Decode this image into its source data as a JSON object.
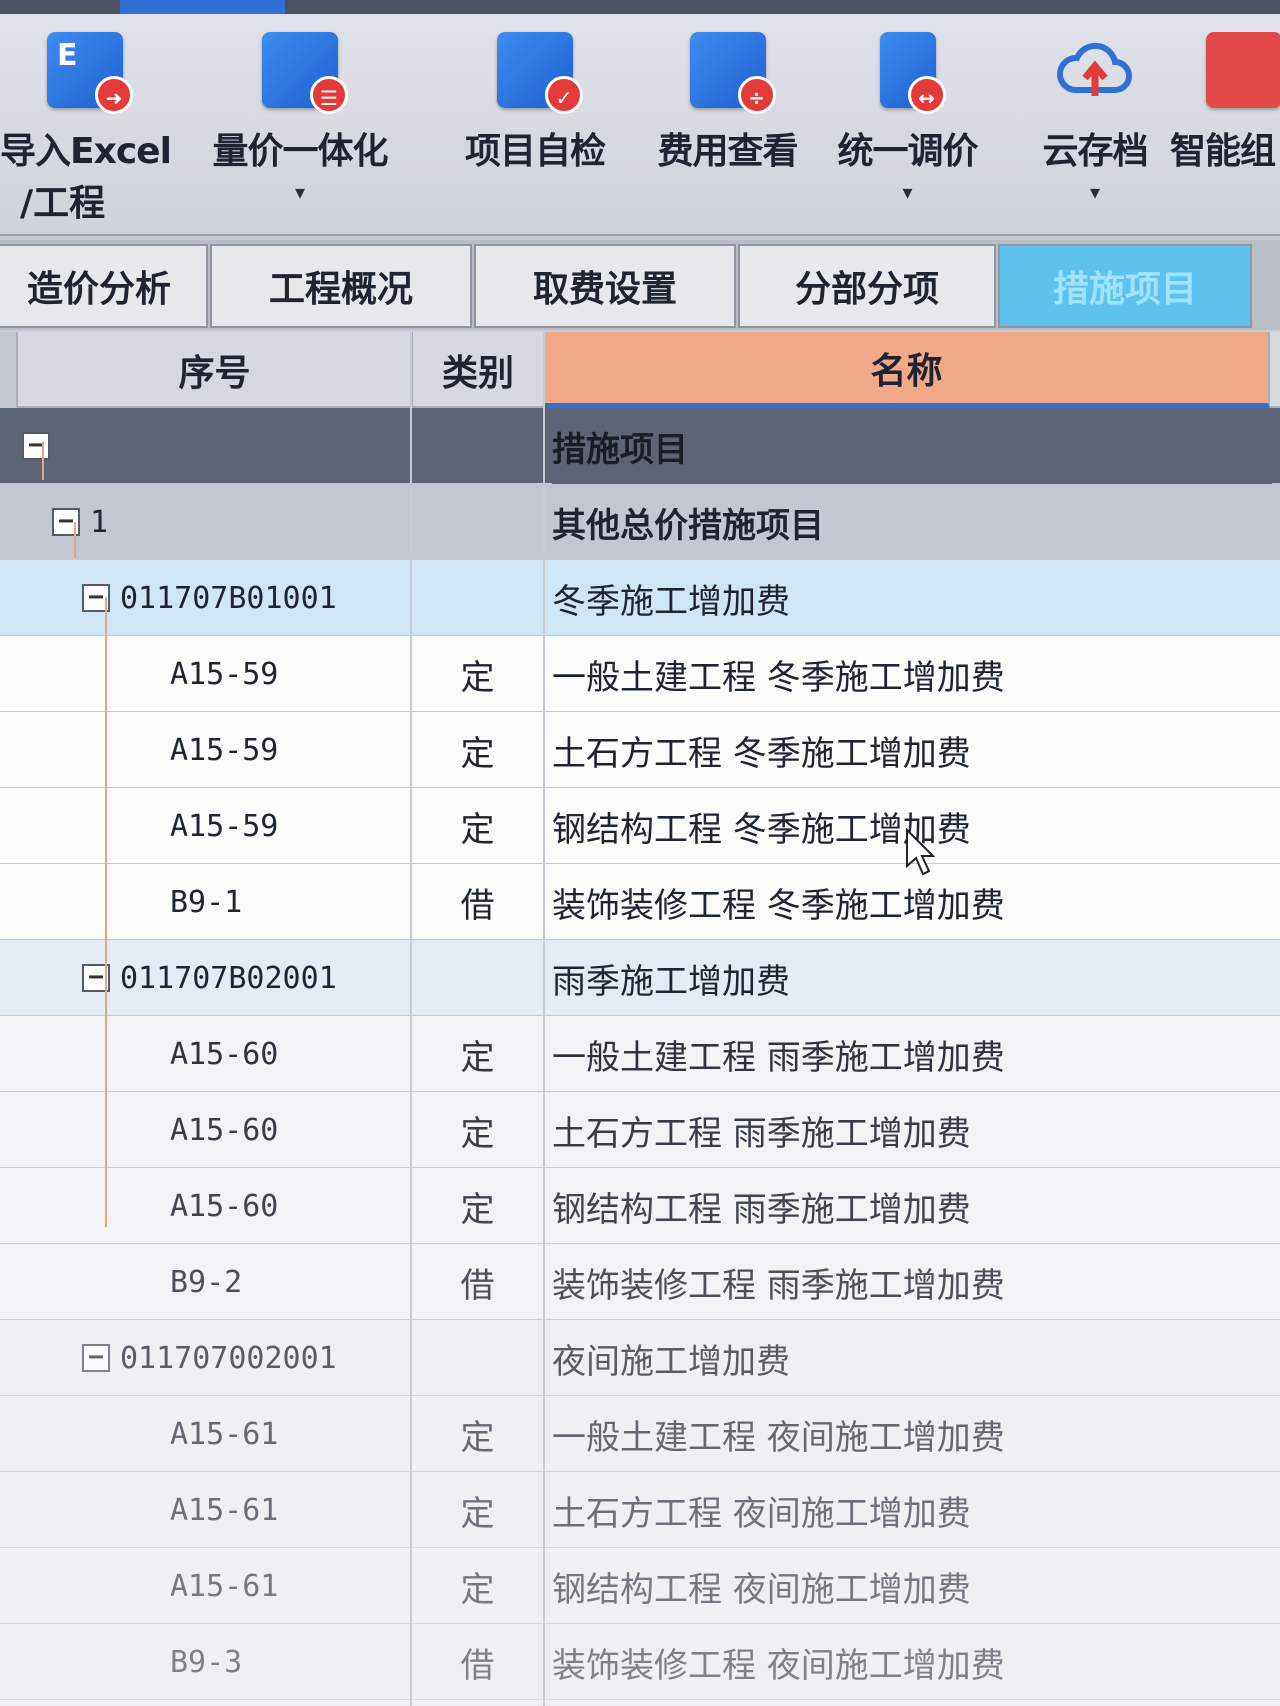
{
  "toolbar": {
    "tools": [
      {
        "label": "导入Excel",
        "label2": "/工程",
        "glyph": "E",
        "icon": "excel-import-icon",
        "caret": "▾"
      },
      {
        "label": "量价一体化",
        "label2": "",
        "glyph": "",
        "icon": "document-list-icon",
        "caret": "▾"
      },
      {
        "label": "项目自检",
        "label2": "",
        "glyph": "",
        "icon": "checklist-icon",
        "caret": ""
      },
      {
        "label": "费用查看",
        "label2": "",
        "glyph": "",
        "icon": "fee-view-icon",
        "caret": ""
      },
      {
        "label": "统一调价",
        "label2": "",
        "glyph": "",
        "icon": "price-adjust-icon",
        "caret": "▾"
      },
      {
        "label": "云存档",
        "label2": "",
        "glyph": "",
        "icon": "cloud-upload-icon",
        "caret": "▾"
      },
      {
        "label": "智能组",
        "label2": "",
        "glyph": "",
        "icon": "smart-group-icon",
        "caret": ""
      }
    ]
  },
  "tabs": [
    "造价分析",
    "工程概况",
    "取费设置",
    "分部分项",
    "措施项目"
  ],
  "columns": {
    "seq": "序号",
    "category": "类别",
    "name": "名称"
  },
  "rows": [
    {
      "toggle": "−",
      "seq": "",
      "category": "",
      "name": "措施项目",
      "level": 0
    },
    {
      "toggle": "−",
      "seq": "1",
      "category": "",
      "name": "其他总价措施项目",
      "level": 1
    },
    {
      "toggle": "−",
      "seq": "011707B01001",
      "category": "",
      "name": "冬季施工增加费",
      "level": 2
    },
    {
      "toggle": "",
      "seq": "A15-59",
      "category": "定",
      "name": "一般土建工程 冬季施工增加费",
      "level": 3
    },
    {
      "toggle": "",
      "seq": "A15-59",
      "category": "定",
      "name": "土石方工程 冬季施工增加费",
      "level": 3
    },
    {
      "toggle": "",
      "seq": "A15-59",
      "category": "定",
      "name": "钢结构工程 冬季施工增加费",
      "level": 3
    },
    {
      "toggle": "",
      "seq": "B9-1",
      "category": "借",
      "name": "装饰装修工程 冬季施工增加费",
      "level": 3
    },
    {
      "toggle": "−",
      "seq": "011707B02001",
      "category": "",
      "name": "雨季施工增加费",
      "level": 2
    },
    {
      "toggle": "",
      "seq": "A15-60",
      "category": "定",
      "name": "一般土建工程 雨季施工增加费",
      "level": 3
    },
    {
      "toggle": "",
      "seq": "A15-60",
      "category": "定",
      "name": "土石方工程 雨季施工增加费",
      "level": 3
    },
    {
      "toggle": "",
      "seq": "A15-60",
      "category": "定",
      "name": "钢结构工程 雨季施工增加费",
      "level": 3
    },
    {
      "toggle": "",
      "seq": "B9-2",
      "category": "借",
      "name": "装饰装修工程 雨季施工增加费",
      "level": 3
    },
    {
      "toggle": "−",
      "seq": "011707002001",
      "category": "",
      "name": "夜间施工增加费",
      "level": 2
    },
    {
      "toggle": "",
      "seq": "A15-61",
      "category": "定",
      "name": "一般土建工程 夜间施工增加费",
      "level": 3
    },
    {
      "toggle": "",
      "seq": "A15-61",
      "category": "定",
      "name": "土石方工程 夜间施工增加费",
      "level": 3
    },
    {
      "toggle": "",
      "seq": "A15-61",
      "category": "定",
      "name": "钢结构工程 夜间施工增加费",
      "level": 3
    },
    {
      "toggle": "",
      "seq": "B9-3",
      "category": "借",
      "name": "装饰装修工程 夜间施工增加费",
      "level": 3
    }
  ]
}
